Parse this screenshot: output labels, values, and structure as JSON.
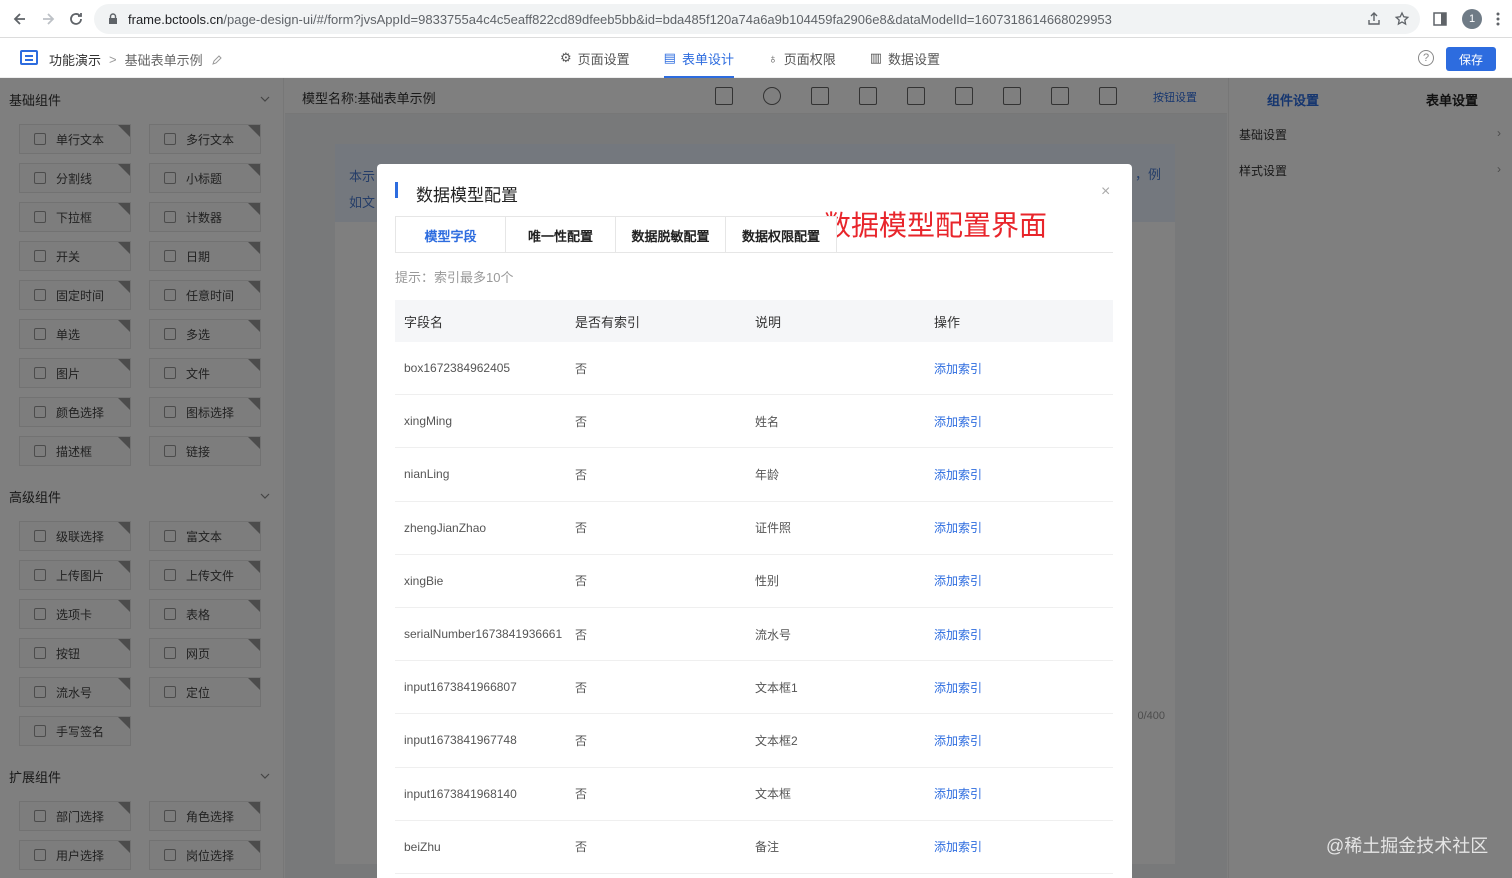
{
  "browser": {
    "url_host": "frame.bctools.cn",
    "url_rest": "/page-design-ui/#/form?jvsAppId=9833755a4c4c5eaff822cd89dfeeb5bb&id=bda485f120a74a6a9b104459fa2906e8&dataModelId=1607318614668029953",
    "profile_initial": "1"
  },
  "header": {
    "crumb_root": "功能演示",
    "crumb_separator": ">",
    "crumb_current": "基础表单示例",
    "tabs": [
      {
        "label": "页面设置",
        "icon": "gear-icon"
      },
      {
        "label": "表单设计",
        "icon": "document-icon"
      },
      {
        "label": "页面权限",
        "icon": "lock-icon"
      },
      {
        "label": "数据设置",
        "icon": "bar-chart-icon"
      }
    ],
    "active_tab": 1,
    "save_label": "保存",
    "help_symbol": "?"
  },
  "left_panel": {
    "groups": [
      {
        "title": "基础组件",
        "items": [
          "单行文本",
          "多行文本",
          "分割线",
          "小标题",
          "下拉框",
          "计数器",
          "开关",
          "日期",
          "固定时间",
          "任意时间",
          "单选",
          "多选",
          "图片",
          "文件",
          "颜色选择",
          "图标选择",
          "描述框",
          "链接"
        ]
      },
      {
        "title": "高级组件",
        "items": [
          "级联选择",
          "富文本",
          "上传图片",
          "上传文件",
          "选项卡",
          "表格",
          "按钮",
          "网页",
          "流水号",
          "定位",
          "手写签名"
        ]
      },
      {
        "title": "扩展组件",
        "items": [
          "部门选择",
          "角色选择",
          "用户选择",
          "岗位选择"
        ]
      }
    ]
  },
  "center": {
    "model_label": "模型名称:基础表单示例",
    "button_settings": "按钮设置",
    "notice_left_1": "本示",
    "notice_left_2": "如文",
    "notice_right": "，例",
    "counter": "0/400"
  },
  "right_panel": {
    "tabs": [
      "组件设置",
      "表单设置"
    ],
    "rows": [
      "基础设置",
      "样式设置"
    ]
  },
  "modal": {
    "title": "数据模型配置",
    "close_symbol": "×",
    "annotation": "数据模型配置界面",
    "tabs": [
      "模型字段",
      "唯一性配置",
      "数据脱敏配置",
      "数据权限配置"
    ],
    "active_tab": 0,
    "hint": "提示：索引最多10个",
    "columns": [
      "字段名",
      "是否有索引",
      "说明",
      "操作"
    ],
    "rows": [
      {
        "field": "box1672384962405",
        "indexed": "否",
        "desc": "",
        "action": "添加索引"
      },
      {
        "field": "xingMing",
        "indexed": "否",
        "desc": "姓名",
        "action": "添加索引"
      },
      {
        "field": "nianLing",
        "indexed": "否",
        "desc": "年龄",
        "action": "添加索引"
      },
      {
        "field": "zhengJianZhao",
        "indexed": "否",
        "desc": "证件照",
        "action": "添加索引"
      },
      {
        "field": "xingBie",
        "indexed": "否",
        "desc": "性别",
        "action": "添加索引"
      },
      {
        "field": "serialNumber1673841936661",
        "indexed": "否",
        "desc": "流水号",
        "action": "添加索引"
      },
      {
        "field": "input1673841966807",
        "indexed": "否",
        "desc": "文本框1",
        "action": "添加索引"
      },
      {
        "field": "input1673841967748",
        "indexed": "否",
        "desc": "文本框2",
        "action": "添加索引"
      },
      {
        "field": "input1673841968140",
        "indexed": "否",
        "desc": "文本框",
        "action": "添加索引"
      },
      {
        "field": "beiZhu",
        "indexed": "否",
        "desc": "备注",
        "action": "添加索引"
      }
    ]
  },
  "watermark": "@稀土掘金技术社区",
  "colors": {
    "accent": "#2d6cdf",
    "annotation": "#e8252b"
  }
}
